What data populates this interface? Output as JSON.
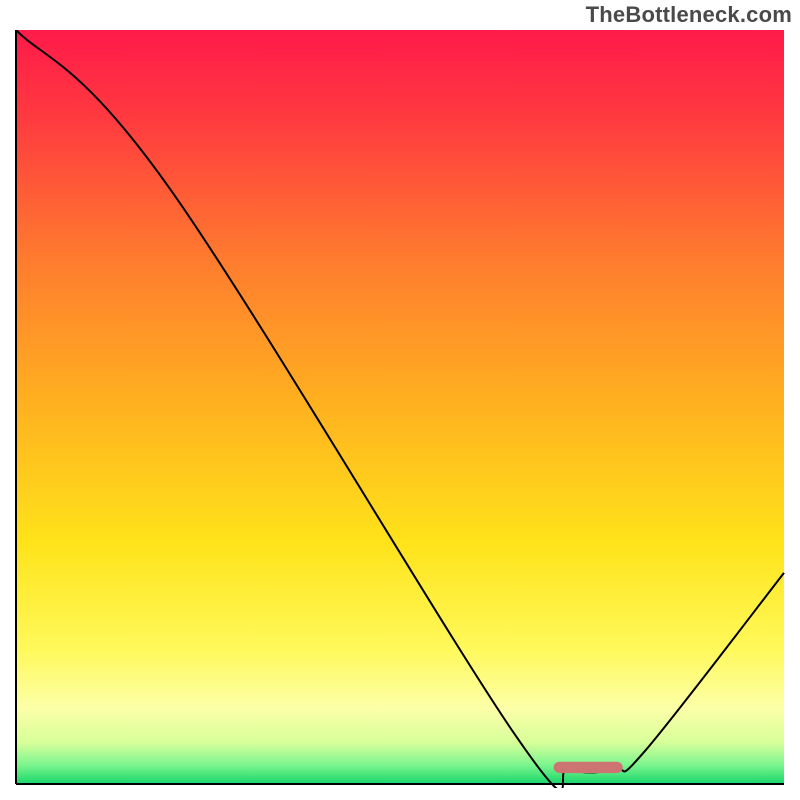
{
  "watermark": "TheBottleneck.com",
  "chart_data": {
    "type": "line",
    "title": "",
    "xlabel": "",
    "ylabel": "",
    "xlim": [
      0,
      100
    ],
    "ylim": [
      0,
      100
    ],
    "grid": false,
    "legend": false,
    "series": [
      {
        "name": "bottleneck-curve",
        "x": [
          0,
          20,
          65,
          72,
          78,
          82,
          100
        ],
        "values": [
          100,
          79,
          6.5,
          2,
          2,
          4.5,
          28
        ],
        "color": "#000000",
        "stroke_width": 2
      }
    ],
    "markers": [
      {
        "name": "optimal-range-bar",
        "kind": "bar-segment",
        "x_start": 70,
        "x_end": 79,
        "y": 2.2,
        "color": "#cd7371",
        "height": 1.5,
        "rx": 0.8
      }
    ],
    "gradient_stops": [
      {
        "offset": 0.0,
        "color": "#ff1a4a"
      },
      {
        "offset": 0.12,
        "color": "#ff3b3f"
      },
      {
        "offset": 0.3,
        "color": "#ff7a2f"
      },
      {
        "offset": 0.5,
        "color": "#ffb21f"
      },
      {
        "offset": 0.68,
        "color": "#ffe31a"
      },
      {
        "offset": 0.82,
        "color": "#fff95a"
      },
      {
        "offset": 0.9,
        "color": "#fcffa8"
      },
      {
        "offset": 0.945,
        "color": "#d7ff9a"
      },
      {
        "offset": 0.975,
        "color": "#7cf58e"
      },
      {
        "offset": 1.0,
        "color": "#17d66b"
      }
    ],
    "axes": {
      "color": "#000000",
      "width": 2
    }
  }
}
